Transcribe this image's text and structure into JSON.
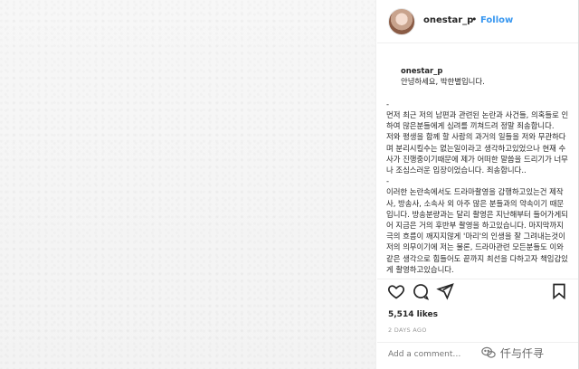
{
  "post": {
    "username": "onestar_p",
    "follow_label": "Follow",
    "dot": "•"
  },
  "caption": {
    "author": "onestar_p",
    "greeting": "안녕하세요, 박한별입니다.",
    "body": "-\n먼저 최근 저의 남편과 관련된 논란과 사건들, 의혹들로 인하여 많은분들에게 심려를 끼쳐드려 정말 죄송합니다.\n저와 평생을 함께 할 사람의 과거의 일들을 저와 무관하다며 분리시킬수는 없는일이라고 생각하고있었으나 현재 수사가 진행중이기때문에 제가 어떠한 말씀을 드리기가 너무나 조심스러운 입장이었습니다. 죄송합니다..\n-\n이러한 논란속에서도 드라마촬영을 감행하고있는건 제작사, 방송사, 소속사 외 아주 많은 분들과의 약속이기 때문입니다. 방송분량과는 달리 촬영은 지난해부터 들어가게되어 지금은 거의 후반부 촬영을 하고있습니다. 마지막까지 극의 흐름이 깨지지않게 '마리'의 인생을 잘 그려내는것이 저의 의무이기에 저는 물론, 드라마관련 모든분들도 이와같은 생각으로 힘들어도 끝까지 최선을 다하고자 책임감있게 촬영하고있습니다."
  },
  "stats": {
    "likes": "5,514 likes",
    "timestamp": "2 DAYS AGO"
  },
  "comment": {
    "placeholder": "Add a comment…"
  },
  "watermark": {
    "text": "仟与仟寻"
  },
  "icons": [
    "heart-icon",
    "comment-icon",
    "share-icon",
    "bookmark-icon",
    "wechat-icon"
  ],
  "colors": {
    "accent": "#3897f0",
    "text": "#262626",
    "muted": "#999999",
    "border": "#efefef"
  }
}
